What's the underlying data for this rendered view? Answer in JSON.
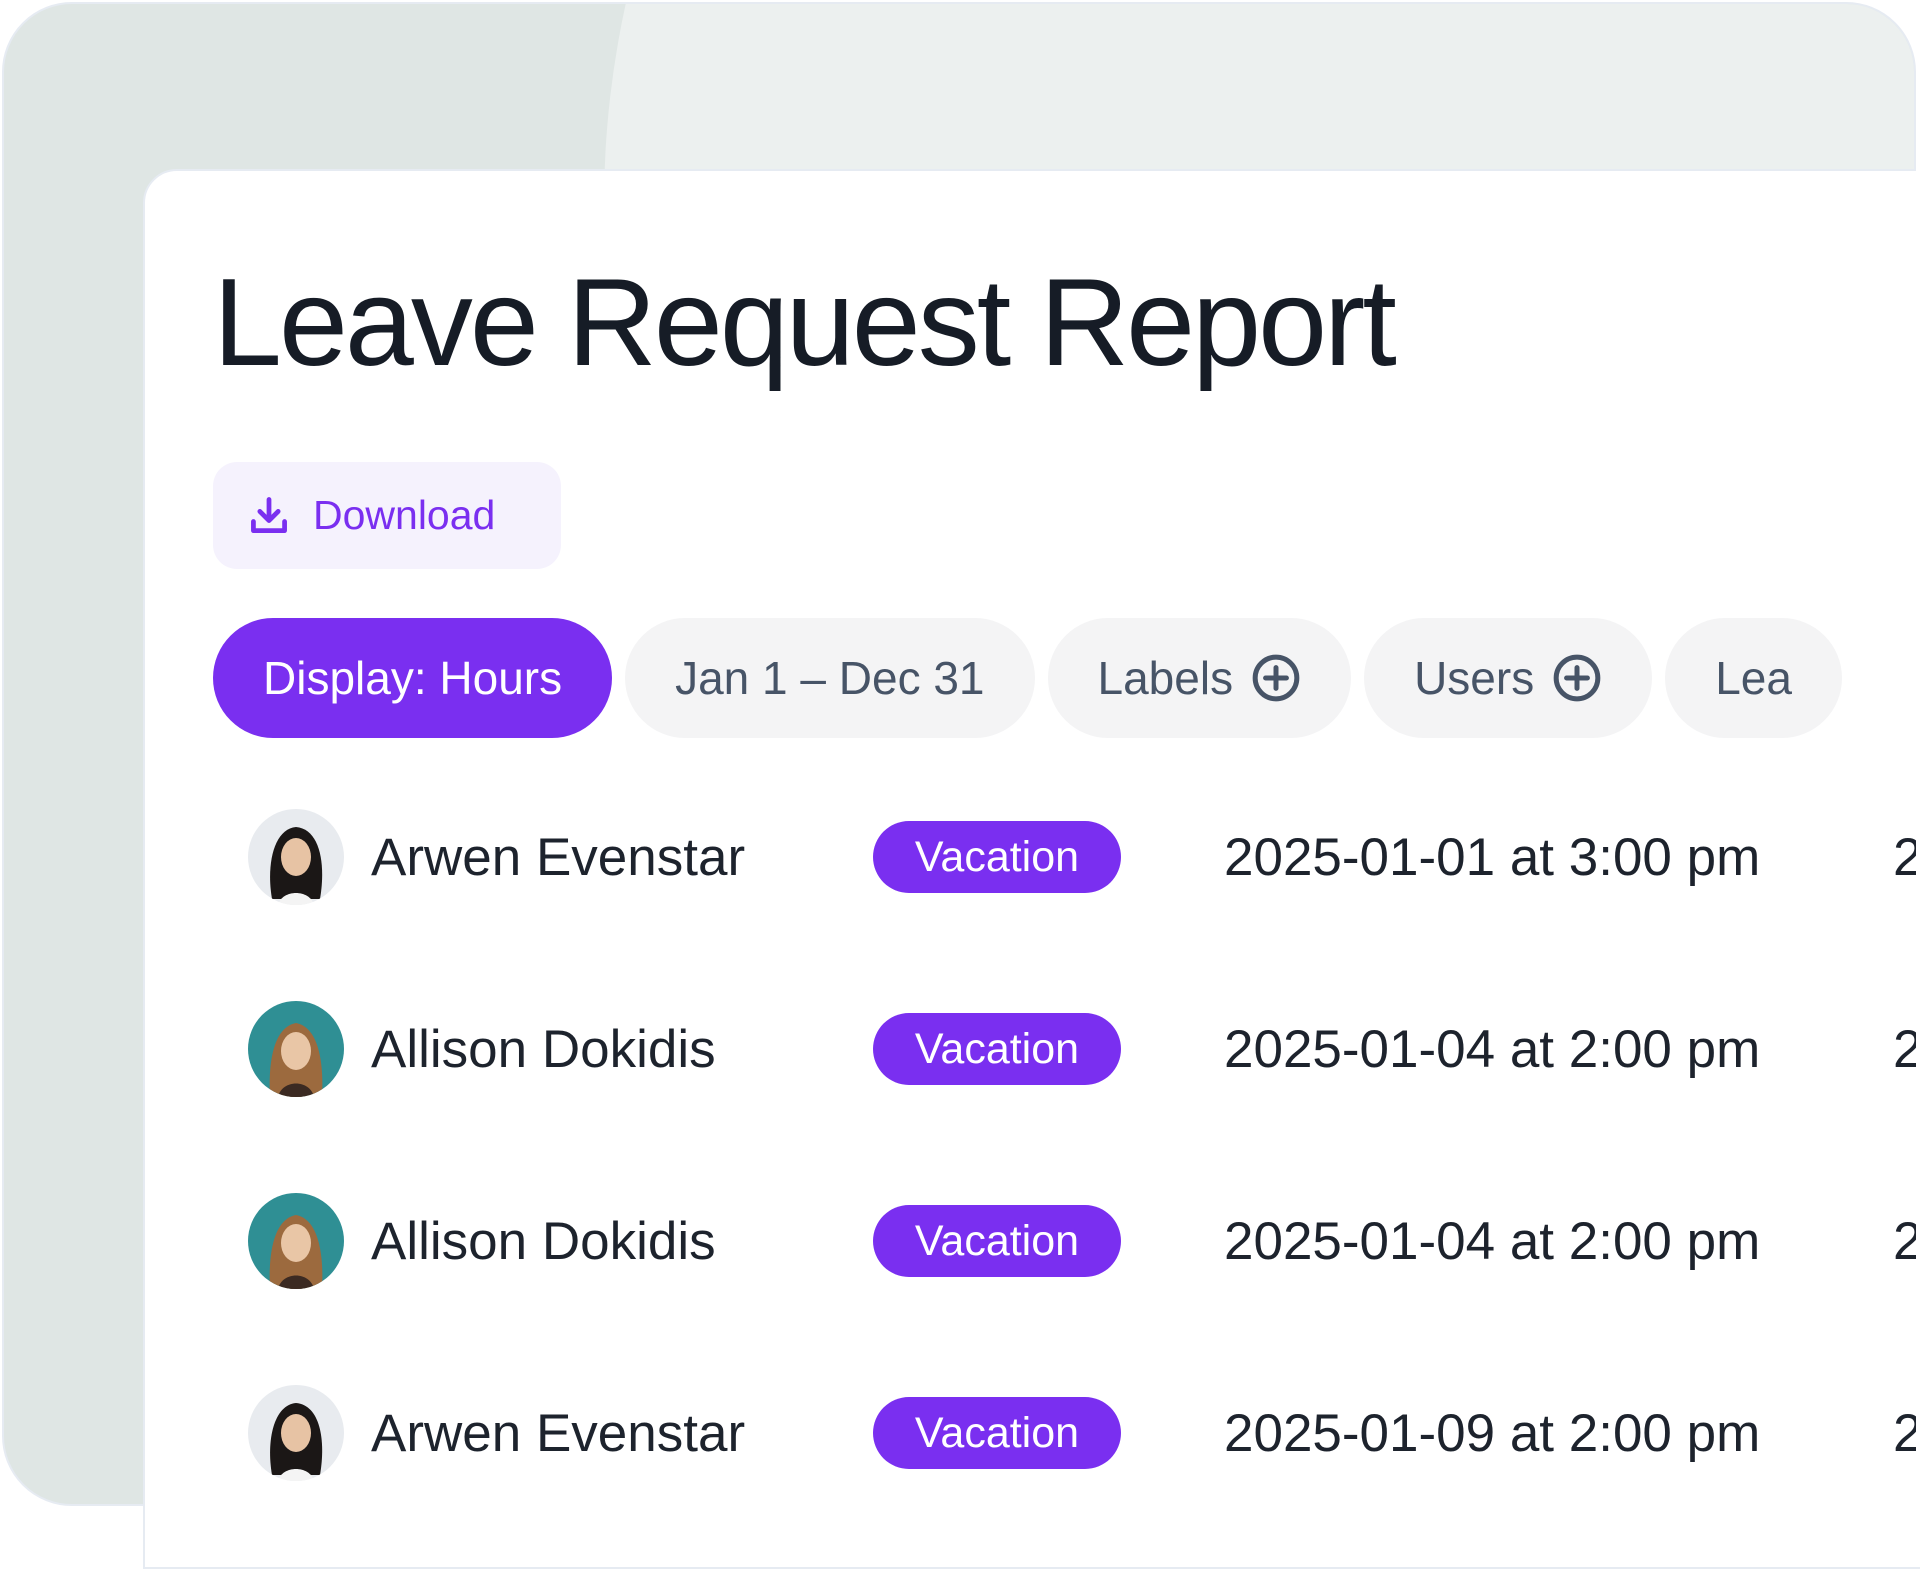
{
  "page": {
    "title": "Leave Request Report",
    "download_label": "Download",
    "accent_color": "#7a2ff0"
  },
  "filters": [
    {
      "label": "Display: Hours",
      "active": true,
      "icon": null
    },
    {
      "label": "Jan 1 – Dec 31",
      "active": false,
      "icon": null
    },
    {
      "label": "Labels",
      "active": false,
      "icon": "plus-circle-icon"
    },
    {
      "label": "Users",
      "active": false,
      "icon": "plus-circle-icon"
    },
    {
      "label": "Lea",
      "active": false,
      "icon": null
    }
  ],
  "rows": [
    {
      "name": "Arwen Evenstar",
      "avatar": "avatar-arwen",
      "label": "Vacation",
      "start": "2025-01-01 at 3:00 pm",
      "next_col": "2"
    },
    {
      "name": "Allison Dokidis",
      "avatar": "avatar-allison",
      "label": "Vacation",
      "start": "2025-01-04 at 2:00 pm",
      "next_col": "2"
    },
    {
      "name": "Allison Dokidis",
      "avatar": "avatar-allison",
      "label": "Vacation",
      "start": "2025-01-04 at 2:00 pm",
      "next_col": "2"
    },
    {
      "name": "Arwen Evenstar",
      "avatar": "avatar-arwen",
      "label": "Vacation",
      "start": "2025-01-09 at 2:00 pm",
      "next_col": "2"
    }
  ]
}
